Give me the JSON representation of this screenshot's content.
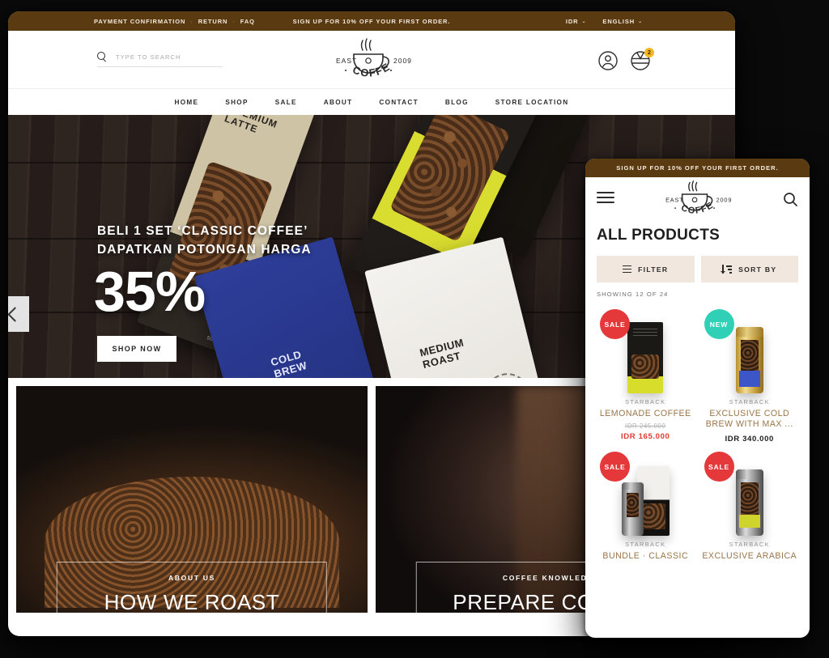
{
  "desktop": {
    "topbar": {
      "links": [
        "PAYMENT CONFIRMATION",
        "RETURN",
        "FAQ"
      ],
      "separator": "·",
      "promo": "SIGN UP FOR 10% OFF YOUR FIRST ORDER.",
      "currency": "IDR",
      "language": "ENGLISH",
      "caret": "⌄"
    },
    "header": {
      "search_placeholder": "TYPE TO SEARCH",
      "search_value": "",
      "logo": {
        "left": "EAST",
        "right": "2009",
        "name": "COFFEE"
      },
      "cart_count": "2"
    },
    "nav": [
      "HOME",
      "SHOP",
      "SALE",
      "ABOUT",
      "CONTACT",
      "BLOG",
      "STORE LOCATION"
    ],
    "hero": {
      "line1": "BELI 1 SET ‘CLASSIC COFFEE’",
      "line2": "DAPATKAN POTONGAN HARGA",
      "discount": "35%",
      "cta": "SHOP NOW",
      "bag_latte": "PREMIUM\nLATTE",
      "bag_blue": "COLD\nBREW",
      "bag_white": "MEDIUM\nROAST",
      "bag_weight": "500GR",
      "prev_arrow": "‹"
    },
    "promos": [
      {
        "kicker": "ABOUT US",
        "title": "HOW WE ROAST"
      },
      {
        "kicker": "COFFEE KNOWLEDGE",
        "title": "PREPARE COFFEE"
      }
    ]
  },
  "mobile": {
    "topbar_promo": "SIGN UP FOR 10% OFF YOUR FIRST ORDER.",
    "logo": {
      "left": "EAST",
      "right": "2009",
      "name": "COFFEE"
    },
    "page_title": "ALL PRODUCTS",
    "filter_label": "FILTER",
    "sort_label": "SORT BY",
    "showing": "SHOWING 12 OF 24",
    "products": [
      {
        "badge": "SALE",
        "badge_type": "sale",
        "brand": "STARBACK",
        "name": "LEMONADE COFFEE",
        "old_price": "IDR 245.000",
        "price": "IDR 165.000",
        "on_sale": true
      },
      {
        "badge": "NEW",
        "badge_type": "new",
        "brand": "STARBACK",
        "name": "EXCLUSIVE COLD BREW WITH MAX ...",
        "old_price": "",
        "price": "IDR 340.000",
        "on_sale": false
      },
      {
        "badge": "SALE",
        "badge_type": "sale",
        "brand": "STARBACK",
        "name": "BUNDLE · CLASSIC",
        "old_price": "",
        "price": "",
        "on_sale": true
      },
      {
        "badge": "SALE",
        "badge_type": "sale",
        "brand": "STARBACK",
        "name": "EXCLUSIVE ARABICA",
        "old_price": "",
        "price": "",
        "on_sale": true
      }
    ]
  },
  "colors": {
    "brand_brown": "#5a3a10",
    "sale_red": "#e5383b",
    "new_teal": "#2fd0b6",
    "badge_yellow": "#f5b822",
    "product_name": "#9b7446",
    "button_beige": "#f2e7de"
  }
}
